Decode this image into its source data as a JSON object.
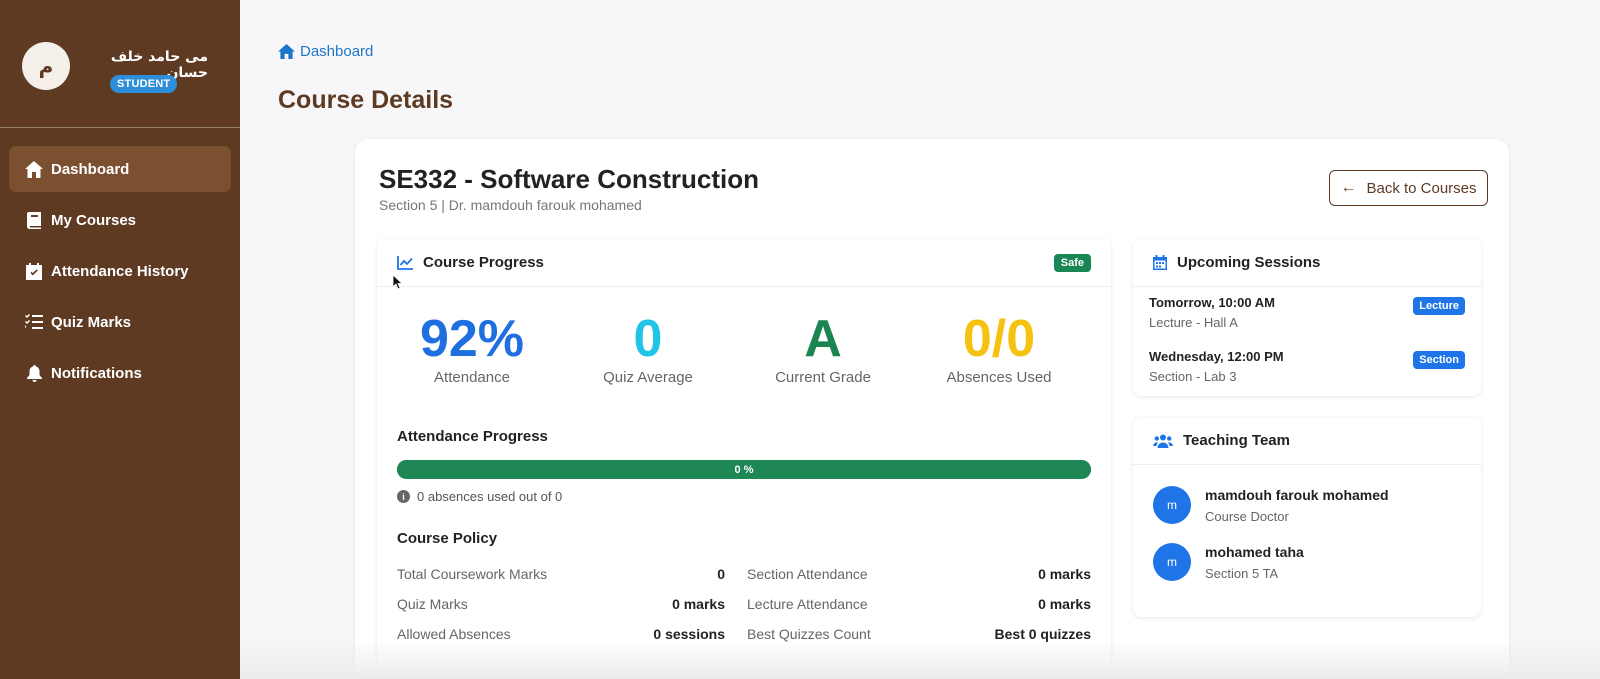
{
  "profile": {
    "avatar_letter": "م",
    "name": "مى حامد خلف حسان",
    "role": "STUDENT"
  },
  "nav": {
    "items": [
      {
        "label": "Dashboard",
        "icon": "home-icon",
        "active": true
      },
      {
        "label": "My Courses",
        "icon": "book-icon"
      },
      {
        "label": "Attendance History",
        "icon": "calendar-check-icon"
      },
      {
        "label": "Quiz Marks",
        "icon": "list-check-icon"
      },
      {
        "label": "Notifications",
        "icon": "bell-icon"
      }
    ]
  },
  "breadcrumb": {
    "label": "Dashboard"
  },
  "page": {
    "title": "Course Details"
  },
  "course": {
    "title": "SE332 - Software Construction",
    "subtitle": "Section 5 | Dr. mamdouh farouk mohamed",
    "back_label": "Back to Courses"
  },
  "progress": {
    "title": "Course Progress",
    "status_badge": "Safe",
    "stats": [
      {
        "value": "92%",
        "label": "Attendance",
        "color": "#1f6fe0"
      },
      {
        "value": "0",
        "label": "Quiz Average",
        "color": "#1fc4e6"
      },
      {
        "value": "A",
        "label": "Current Grade",
        "color": "#1a8550"
      },
      {
        "value": "0/0",
        "label": "Absences Used",
        "color": "#f5c211"
      }
    ],
    "attendance_progress": {
      "title": "Attendance Progress",
      "percent_label": "0 %",
      "fill_fraction": 1.0,
      "note": "0 absences used out of 0"
    },
    "policy": {
      "title": "Course Policy",
      "rows": [
        {
          "label": "Total Coursework Marks",
          "value": "0"
        },
        {
          "label": "Section Attendance",
          "value": "0 marks"
        },
        {
          "label": "Quiz Marks",
          "value": "0 marks"
        },
        {
          "label": "Lecture Attendance",
          "value": "0 marks"
        },
        {
          "label": "Allowed Absences",
          "value": "0 sessions"
        },
        {
          "label": "Best Quizzes Count",
          "value": "Best 0 quizzes"
        }
      ]
    }
  },
  "sessions": {
    "title": "Upcoming Sessions",
    "items": [
      {
        "time": "Tomorrow, 10:00 AM",
        "place": "Lecture - Hall A",
        "tag": "Lecture"
      },
      {
        "time": "Wednesday, 12:00 PM",
        "place": "Section - Lab 3",
        "tag": "Section"
      }
    ]
  },
  "team": {
    "title": "Teaching Team",
    "members": [
      {
        "initial": "m",
        "name": "mamdouh farouk mohamed",
        "role": "Course Doctor"
      },
      {
        "initial": "m",
        "name": "mohamed taha",
        "role": "Section 5 TA"
      }
    ]
  },
  "colors": {
    "sidebar": "#5e3a22",
    "accent": "#1f75e8",
    "success": "#198754"
  }
}
